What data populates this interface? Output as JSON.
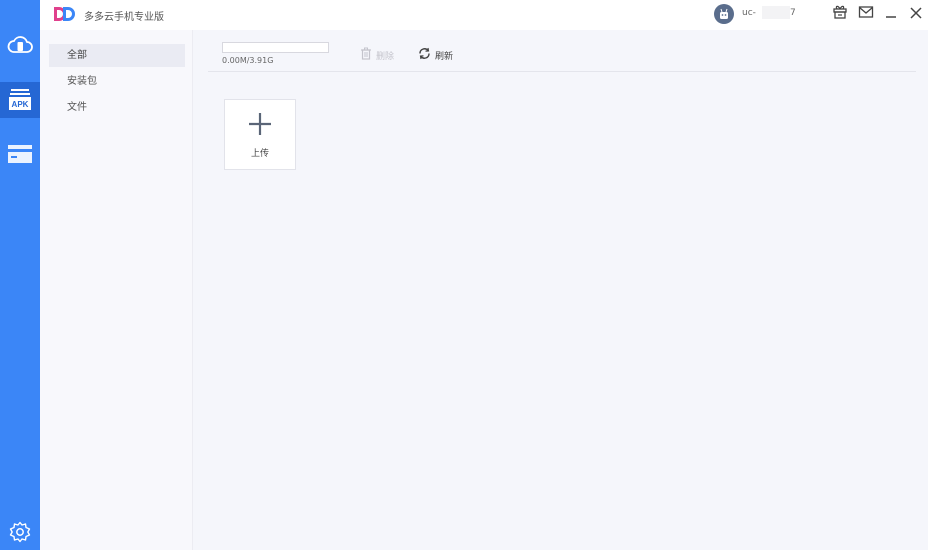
{
  "app": {
    "title": "多多云手机专业版",
    "logo_icon": "dd-logo-icon",
    "accent_color": "#3b86f7"
  },
  "user": {
    "name_prefix": "uc-",
    "name_suffix": "7",
    "avatar_icon": "robot-avatar-icon"
  },
  "window_controls": [
    {
      "name": "gift-icon"
    },
    {
      "name": "mail-icon"
    },
    {
      "name": "minimize-icon"
    },
    {
      "name": "close-icon"
    }
  ],
  "rail": {
    "items": [
      {
        "name": "cloud-phone-icon",
        "active": false
      },
      {
        "name": "apk-icon",
        "label": "APK",
        "active": true
      },
      {
        "name": "card-icon",
        "active": false
      }
    ],
    "settings_icon": "gear-icon"
  },
  "subnav": {
    "items": [
      {
        "label": "全部",
        "active": true
      },
      {
        "label": "安装包",
        "active": false
      },
      {
        "label": "文件",
        "active": false
      }
    ]
  },
  "toolbar": {
    "storage_text": "0.00M/3.91G",
    "storage_used_fraction": 0,
    "delete_label": "删除",
    "refresh_label": "刷新"
  },
  "upload": {
    "label": "上传"
  }
}
